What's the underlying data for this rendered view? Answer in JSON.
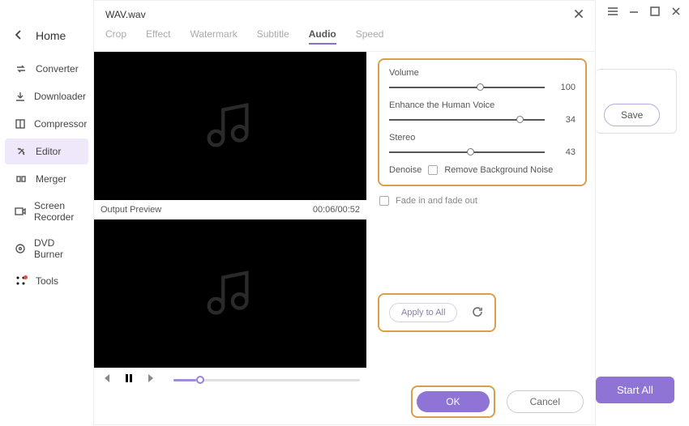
{
  "titlebar": {},
  "home": {
    "label": "Home"
  },
  "sidebar": {
    "items": [
      {
        "label": "Converter"
      },
      {
        "label": "Downloader"
      },
      {
        "label": "Compressor"
      },
      {
        "label": "Editor"
      },
      {
        "label": "Merger"
      },
      {
        "label": "Screen Recorder"
      },
      {
        "label": "DVD Burner"
      },
      {
        "label": "Tools"
      }
    ]
  },
  "dialog": {
    "title": "WAV.wav",
    "tabs": [
      {
        "label": "Crop"
      },
      {
        "label": "Effect"
      },
      {
        "label": "Watermark"
      },
      {
        "label": "Subtitle"
      },
      {
        "label": "Audio"
      },
      {
        "label": "Speed"
      }
    ],
    "preview": {
      "label": "Output Preview",
      "time": "00:06/00:52"
    },
    "audio": {
      "volume": {
        "label": "Volume",
        "value": 100,
        "pct": 56
      },
      "enhance": {
        "label": "Enhance the Human Voice",
        "value": 34,
        "pct": 82
      },
      "stereo": {
        "label": "Stereo",
        "value": 43,
        "pct": 50
      },
      "denoise": {
        "label": "Denoise",
        "checkbox_label": "Remove Background Noise"
      },
      "fade": {
        "label": "Fade in and fade out"
      }
    },
    "apply": {
      "label": "Apply to All"
    },
    "ok": {
      "label": "OK"
    },
    "cancel": {
      "label": "Cancel"
    }
  },
  "right": {
    "save": "Save",
    "start_all": "Start All"
  }
}
